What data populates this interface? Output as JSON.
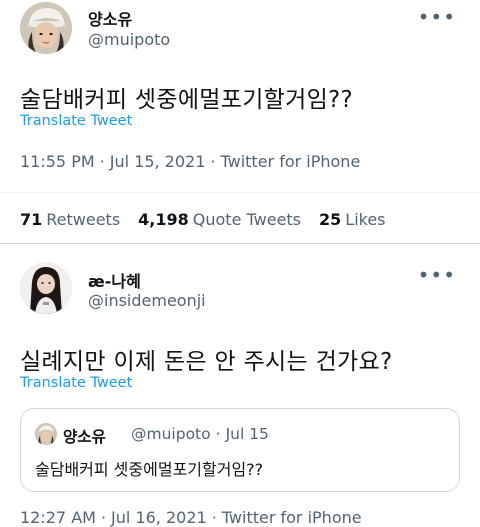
{
  "tweet1": {
    "display_name": "양소유",
    "handle": "@muipoto",
    "text": "술담배커피 셋중에멀포기할거임??",
    "translate_label": "Translate Tweet",
    "time": "11:55 PM",
    "date": "Jul 15, 2021",
    "source": "Twitter for iPhone",
    "retweets_count": "71",
    "retweets_label": "Retweets",
    "quote_count": "4,198",
    "quote_label": "Quote Tweets",
    "likes_count": "25",
    "likes_label": "Likes"
  },
  "tweet2": {
    "display_name": "æ-나혜",
    "handle": "@insidemeonji",
    "text": "실례지만 이제 돈은 안 주시는 건가요?",
    "translate_label": "Translate Tweet",
    "time": "12:27 AM",
    "date": "Jul 16, 2021",
    "source": "Twitter for iPhone",
    "quoted": {
      "display_name": "양소유",
      "handle": "@muipoto",
      "date": "Jul 15",
      "text": "술담배커피 셋중에멀포기할거임??"
    }
  },
  "dot_separator": "·",
  "more_icon_glyph": "•••",
  "colors": {
    "text_primary": "#0f1419",
    "text_secondary": "#536471",
    "link": "#1d9bf0",
    "border": "#cfd9de"
  }
}
